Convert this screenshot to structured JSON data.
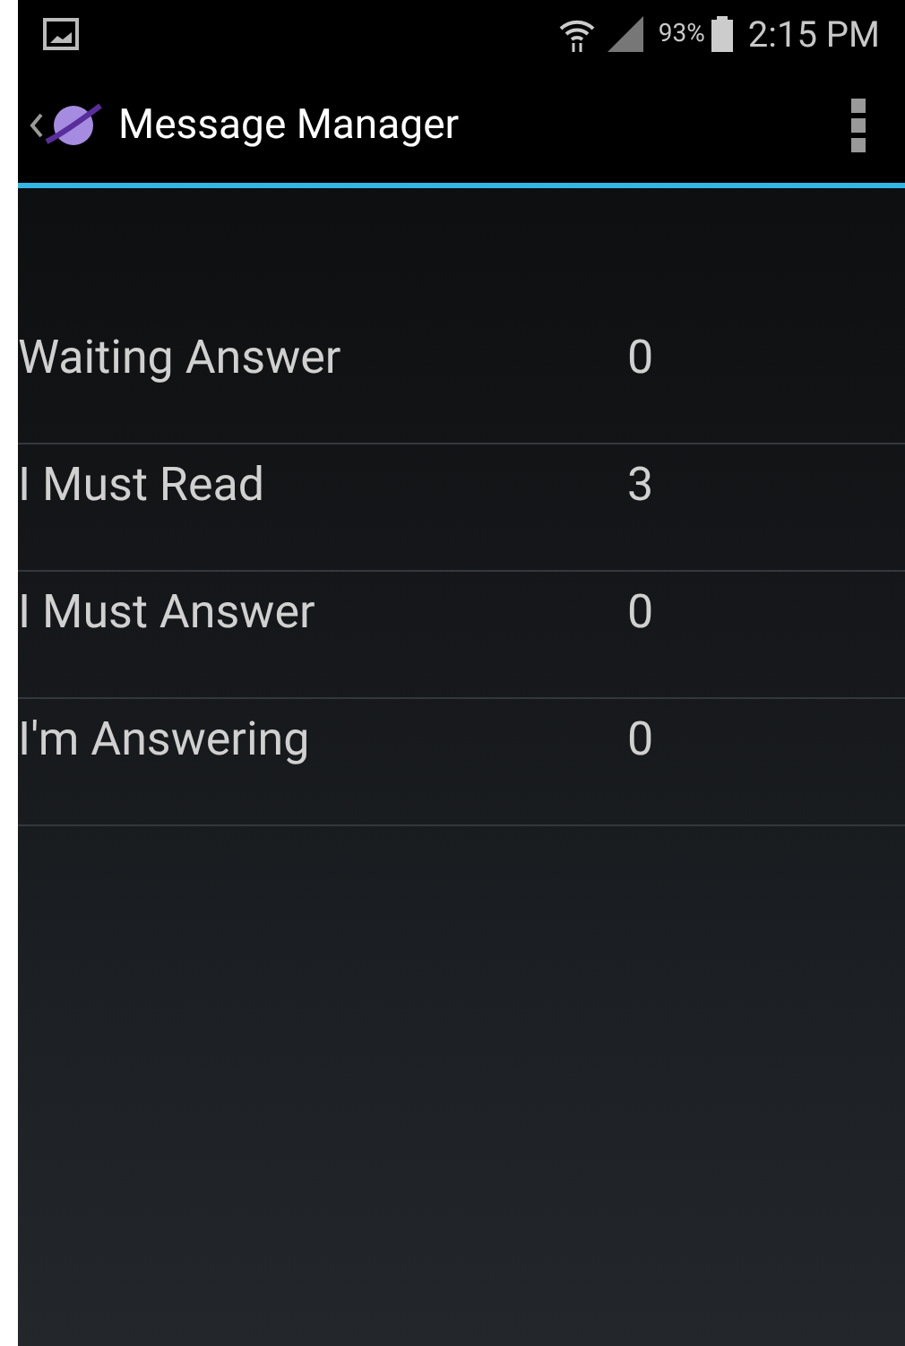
{
  "status_bar": {
    "battery": "93%",
    "time": "2:15 PM"
  },
  "action_bar": {
    "title": "Message Manager"
  },
  "rows": [
    {
      "label": "Waiting Answer",
      "count": "0"
    },
    {
      "label": "I Must Read",
      "count": "3"
    },
    {
      "label": "I Must Answer",
      "count": "0"
    },
    {
      "label": "I'm Answering",
      "count": "0"
    }
  ]
}
